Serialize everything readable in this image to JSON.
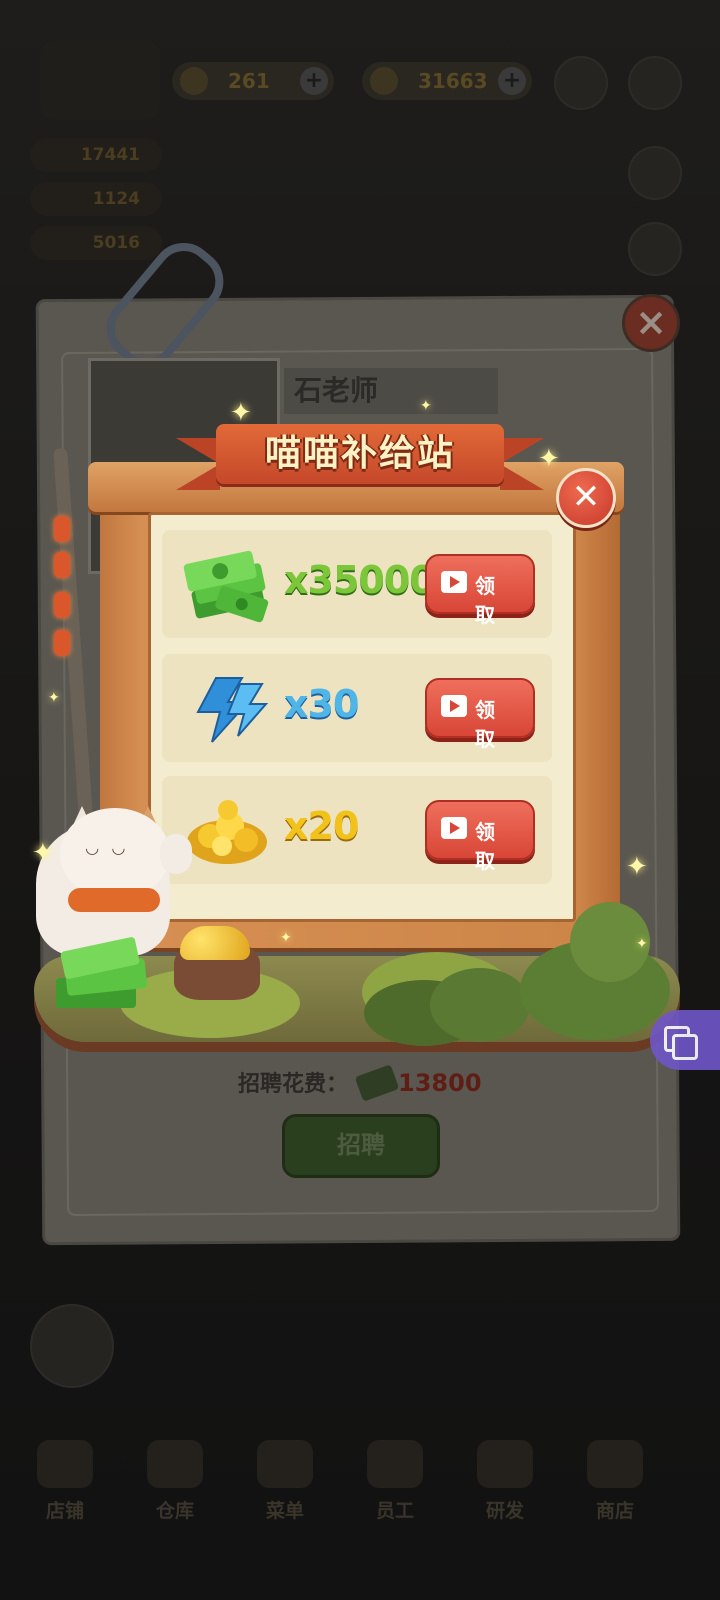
{
  "hud": {
    "gems": "261",
    "energy": "31663",
    "stat1": "17441",
    "stat2": "1124",
    "stat3": "5016"
  },
  "recruit_card": {
    "teacher_name": "石老师",
    "cost_label": "招聘花费：",
    "cost_value": "13800",
    "recruit_button": "招聘"
  },
  "bottom_nav": [
    "店铺",
    "仓库",
    "菜单",
    "员工",
    "研发",
    "商店"
  ],
  "popup": {
    "title": "喵喵补给站",
    "close_label": "✕",
    "rewards": [
      {
        "icon": "cash-stack-icon",
        "amount": "x35000",
        "color": "#7cc63a",
        "button": "领 取"
      },
      {
        "icon": "lightning-energy-icon",
        "amount": "x30",
        "color": "#4fb4e6",
        "button": "领 取"
      },
      {
        "icon": "gold-nugget-icon",
        "amount": "x20",
        "color": "#f0c21a",
        "button": "领 取"
      }
    ]
  },
  "colors": {
    "claim_button": "#d84637",
    "board": "#f4ecce",
    "frame_wood": "#c8803f",
    "title_ribbon": "#d9582f"
  }
}
